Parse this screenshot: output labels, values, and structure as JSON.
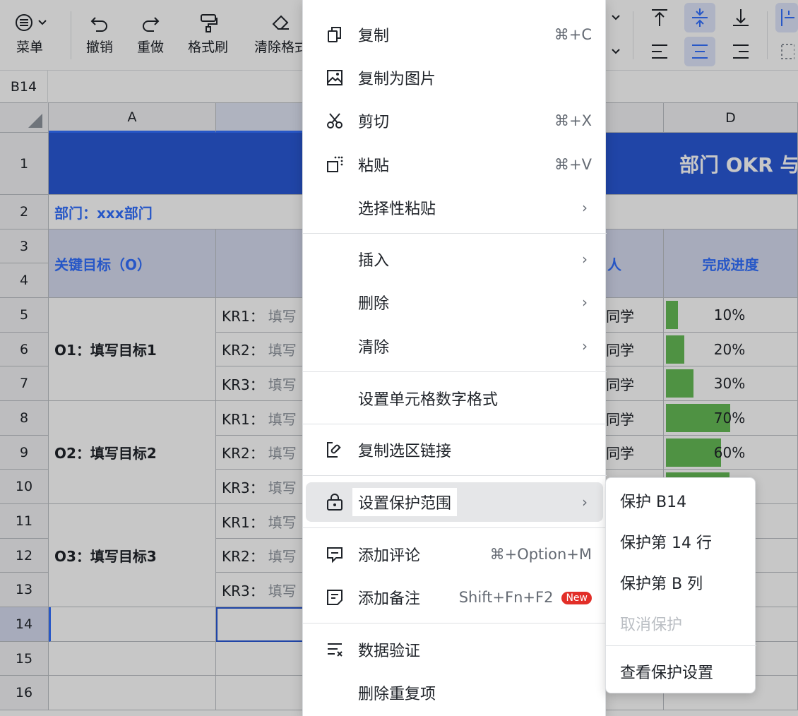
{
  "toolbar": {
    "menu": "菜单",
    "undo": "撤销",
    "redo": "重做",
    "format_painter": "格式刷",
    "clear_format": "清除格式"
  },
  "formula_bar": {
    "cell_ref": "B14"
  },
  "sheet": {
    "col_a": "A",
    "col_d": "D",
    "title": "部门 OKR 与",
    "department": "部门：xxx部门",
    "header_o": "关键目标（O）",
    "header_owner_tail": "人",
    "header_progress": "完成进度",
    "rows": [
      "1",
      "2",
      "3",
      "4",
      "5",
      "6",
      "7",
      "8",
      "9",
      "10",
      "11",
      "12",
      "13",
      "14",
      "15",
      "16"
    ],
    "objectives": [
      "O1：填写目标1",
      "O2：填写目标2",
      "O3：填写目标3"
    ],
    "kr_labels": [
      "KR1：",
      "KR2：",
      "KR3：",
      "KR1：",
      "KR2：",
      "KR3：",
      "KR1：",
      "KR2：",
      "KR3："
    ],
    "kr_placeholder": "填写",
    "owner_tail": "同学",
    "progress": [
      {
        "label": "10%",
        "value": 0.1
      },
      {
        "label": "20%",
        "value": 0.2
      },
      {
        "label": "30%",
        "value": 0.3
      },
      {
        "label": "70%",
        "value": 0.7
      },
      {
        "label": "60%",
        "value": 0.6
      }
    ],
    "colors": {
      "progress_fill": "#66bb56",
      "title_band": "#2a59d6",
      "accent": "#3370ff"
    }
  },
  "context_menu": {
    "copy": "复制",
    "copy_sc": "⌘+C",
    "copy_image": "复制为图片",
    "cut": "剪切",
    "cut_sc": "⌘+X",
    "paste": "粘贴",
    "paste_sc": "⌘+V",
    "paste_special": "选择性粘贴",
    "insert": "插入",
    "delete": "删除",
    "clear": "清除",
    "number_format": "设置单元格数字格式",
    "copy_link": "复制选区链接",
    "protect_range": "设置保护范围",
    "add_comment": "添加评论",
    "add_comment_sc": "⌘+Option+M",
    "add_note": "添加备注",
    "add_note_sc": "Shift+Fn+F2",
    "new_badge": "New",
    "data_validation": "数据验证",
    "remove_duplicates": "删除重复项"
  },
  "submenu": {
    "protect_cell": "保护 B14",
    "protect_row": "保护第 14 行",
    "protect_col": "保护第 B 列",
    "unprotect": "取消保护",
    "view_settings": "查看保护设置"
  }
}
